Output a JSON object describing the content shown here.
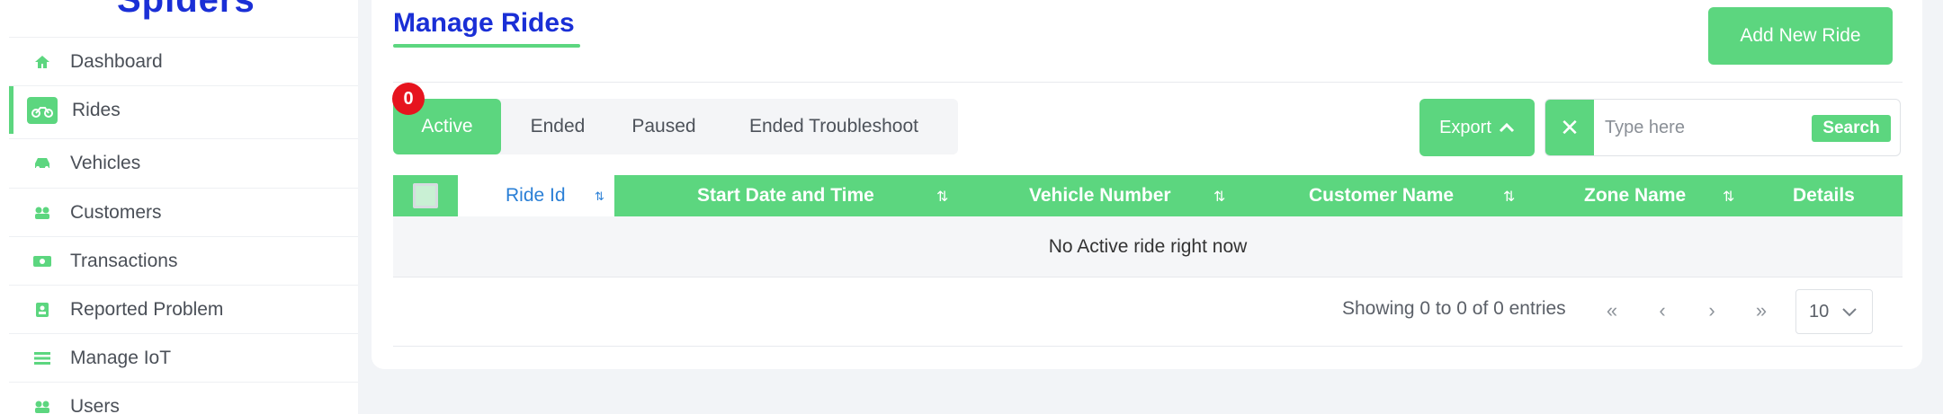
{
  "sidebar": {
    "brand": "Spiders",
    "items": [
      {
        "label": "Dashboard",
        "icon": "home-icon"
      },
      {
        "label": "Rides",
        "icon": "motorbike-icon"
      },
      {
        "label": "Vehicles",
        "icon": "car-icon"
      },
      {
        "label": "Customers",
        "icon": "users-icon"
      },
      {
        "label": "Transactions",
        "icon": "money-icon"
      },
      {
        "label": "Reported Problem",
        "icon": "report-icon"
      },
      {
        "label": "Manage IoT",
        "icon": "list-icon"
      },
      {
        "label": "Users",
        "icon": "users-icon"
      }
    ],
    "active_item": "Rides"
  },
  "header": {
    "title": "Manage Rides",
    "add_button": "Add New Ride"
  },
  "tabs": {
    "items": [
      "Active",
      "Ended",
      "Paused",
      "Ended Troubleshoot"
    ],
    "active": "Active",
    "active_count": "0"
  },
  "toolbar": {
    "export_label": "Export",
    "clear_symbol": "✕",
    "search_placeholder": "Type here",
    "search_value": "",
    "search_button": "Search"
  },
  "table": {
    "columns": [
      "Ride Id",
      "Start Date and Time",
      "Vehicle Number",
      "Customer Name",
      "Zone Name",
      "Details"
    ],
    "sorted_column": "Ride Id",
    "empty_message": "No Active ride right now"
  },
  "pagination": {
    "showing_text": "Showing 0 to 0 of 0 entries",
    "first": "«",
    "prev": "‹",
    "next": "›",
    "last": "»",
    "per_page": "10"
  },
  "colors": {
    "accent": "#5cd67f",
    "brand": "#1a2fd6",
    "badge": "#e6141e",
    "sort_link": "#2a7fd6"
  }
}
